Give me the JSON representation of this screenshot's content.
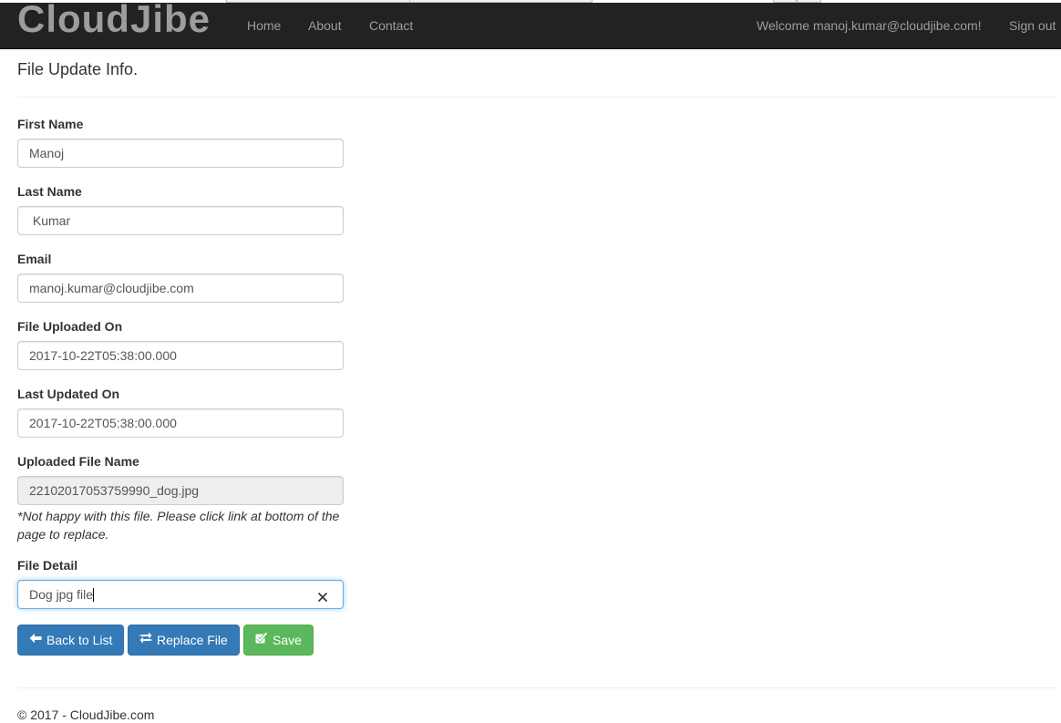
{
  "navbar": {
    "brand": "CloudJibe",
    "links": [
      {
        "label": "Home"
      },
      {
        "label": "About"
      },
      {
        "label": "Contact"
      }
    ],
    "welcome": "Welcome manoj.kumar@cloudjibe.com!",
    "sign_out": "Sign out"
  },
  "page": {
    "title": "File Update Info."
  },
  "form": {
    "first_name": {
      "label": "First Name",
      "value": "Manoj"
    },
    "last_name": {
      "label": "Last Name",
      "value": " Kumar"
    },
    "email": {
      "label": "Email",
      "value": "manoj.kumar@cloudjibe.com"
    },
    "uploaded_on": {
      "label": "File Uploaded On",
      "value": "2017-10-22T05:38:00.000"
    },
    "updated_on": {
      "label": "Last Updated On",
      "value": "2017-10-22T05:38:00.000"
    },
    "file_name": {
      "label": "Uploaded File Name",
      "value": "22102017053759990_dog.jpg"
    },
    "note": "*Not happy with this file. Please click link at bottom of the page to replace.",
    "file_detail": {
      "label": "File Detail",
      "value": "Dog jpg file"
    }
  },
  "buttons": {
    "back": {
      "label": "Back to List",
      "icon": "arrow-left-icon"
    },
    "replace": {
      "label": "Replace File",
      "icon": "transfer-icon"
    },
    "save": {
      "label": "Save",
      "icon": "check-square-icon"
    }
  },
  "footer": {
    "copyright": "© 2017 - CloudJibe.com"
  },
  "colors": {
    "navbar_bg": "#222222",
    "nav_text": "#9d9d9d",
    "primary": "#337ab7",
    "success": "#5cb85c",
    "focus": "#66afe9"
  }
}
